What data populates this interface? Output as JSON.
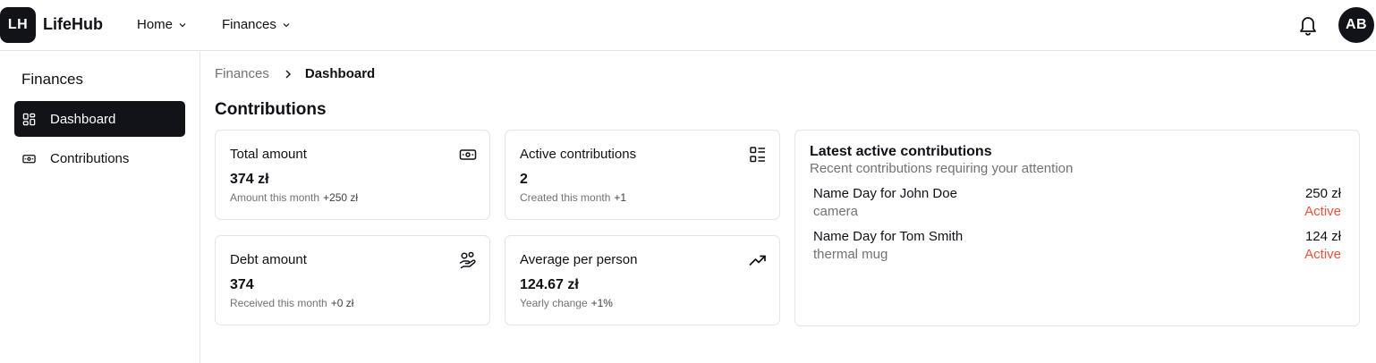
{
  "app": {
    "logo_initials": "LH",
    "name": "LifeHub"
  },
  "topnav": [
    {
      "label": "Home"
    },
    {
      "label": "Finances"
    }
  ],
  "user": {
    "initials": "AB"
  },
  "sidebar": {
    "title": "Finances",
    "items": [
      {
        "label": "Dashboard",
        "icon": "dashboard-grid-icon",
        "active": true
      },
      {
        "label": "Contributions",
        "icon": "banknote-icon",
        "active": false
      }
    ]
  },
  "breadcrumb": {
    "parent": "Finances",
    "current": "Dashboard"
  },
  "page": {
    "title": "Contributions"
  },
  "stats": [
    {
      "label": "Total amount",
      "value": "374 zł",
      "sub": "Amount this month",
      "delta": "+250 zł",
      "icon": "banknote-icon"
    },
    {
      "label": "Active contributions",
      "value": "2",
      "sub": "Created this month",
      "delta": "+1",
      "icon": "list-checks-icon"
    },
    {
      "label": "Debt amount",
      "value": "374",
      "sub": "Received this month",
      "delta": "+0 zł",
      "icon": "hand-coins-icon"
    },
    {
      "label": "Average per person",
      "value": "124.67 zł",
      "sub": "Yearly change",
      "delta": "+1%",
      "icon": "trending-up-icon"
    }
  ],
  "latest": {
    "title": "Latest active contributions",
    "subtitle": "Recent contributions requiring your attention",
    "items": [
      {
        "name": "Name Day for John Doe",
        "item": "camera",
        "amount": "250 zł",
        "status": "Active"
      },
      {
        "name": "Name Day for Tom Smith",
        "item": "thermal mug",
        "amount": "124 zł",
        "status": "Active"
      }
    ]
  },
  "colors": {
    "primary": "#111318",
    "muted_text": "#71717a",
    "border": "#e4e4e7",
    "status_active": "#e5533d"
  }
}
